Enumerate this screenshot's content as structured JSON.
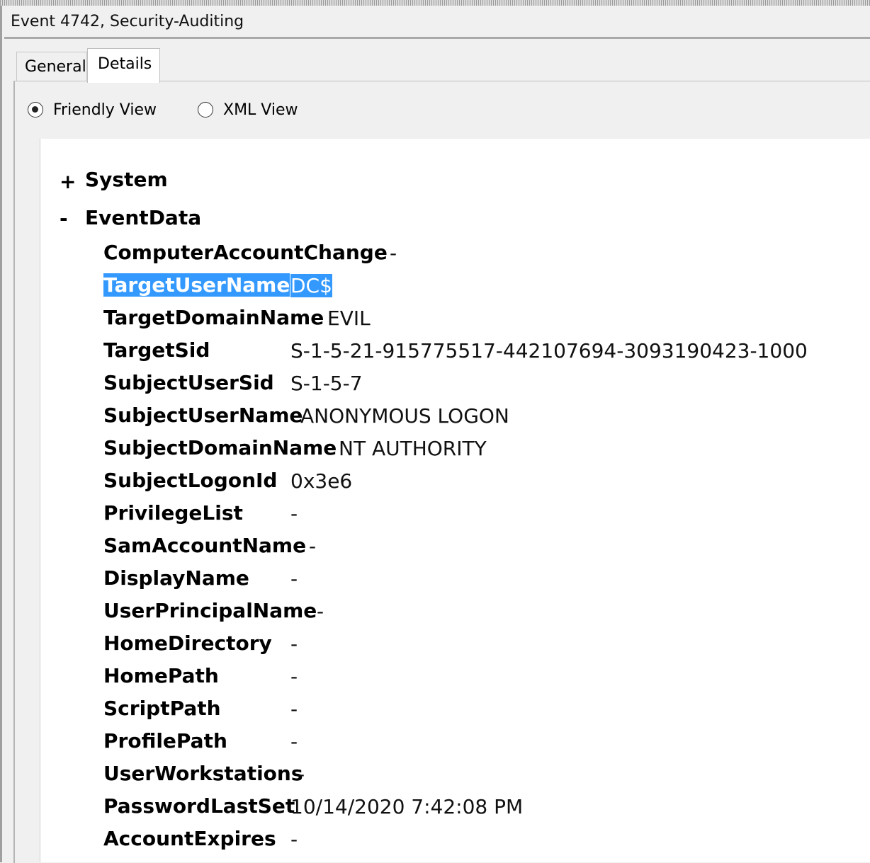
{
  "window": {
    "title": "Event 4742, Security-Auditing"
  },
  "tabs": [
    {
      "label": "General",
      "active": false
    },
    {
      "label": "Details",
      "active": true
    }
  ],
  "view_options": {
    "friendly": {
      "label": "Friendly View",
      "selected": true
    },
    "xml": {
      "label": "XML View",
      "selected": false
    }
  },
  "tree": {
    "system": {
      "toggle": "+",
      "label": "System"
    },
    "eventdata": {
      "toggle": "-",
      "label": "EventData"
    }
  },
  "fields": [
    {
      "key": "ComputerAccountChange",
      "value": "-"
    },
    {
      "key": "TargetUserName",
      "value": "DC$",
      "selected": true
    },
    {
      "key": "TargetDomainName",
      "value": "EVIL"
    },
    {
      "key": "TargetSid",
      "value": "S-1-5-21-915775517-442107694-3093190423-1000"
    },
    {
      "key": "SubjectUserSid",
      "value": "S-1-5-7"
    },
    {
      "key": "SubjectUserName",
      "value": "ANONYMOUS LOGON"
    },
    {
      "key": "SubjectDomainName",
      "value": "NT AUTHORITY"
    },
    {
      "key": "SubjectLogonId",
      "value": "0x3e6"
    },
    {
      "key": "PrivilegeList",
      "value": "-"
    },
    {
      "key": "SamAccountName",
      "value": "-"
    },
    {
      "key": "DisplayName",
      "value": "-"
    },
    {
      "key": "UserPrincipalName",
      "value": "-"
    },
    {
      "key": "HomeDirectory",
      "value": "-"
    },
    {
      "key": "HomePath",
      "value": "-"
    },
    {
      "key": "ScriptPath",
      "value": "-"
    },
    {
      "key": "ProfilePath",
      "value": "-"
    },
    {
      "key": "UserWorkstations",
      "value": "-"
    },
    {
      "key": "PasswordLastSet",
      "value": "10/14/2020 7:42:08 PM"
    },
    {
      "key": "AccountExpires",
      "value": "-"
    }
  ],
  "colors": {
    "selection": "#3399ff",
    "content_bg": "#ffffff",
    "window_bg": "#f0f0f0"
  }
}
